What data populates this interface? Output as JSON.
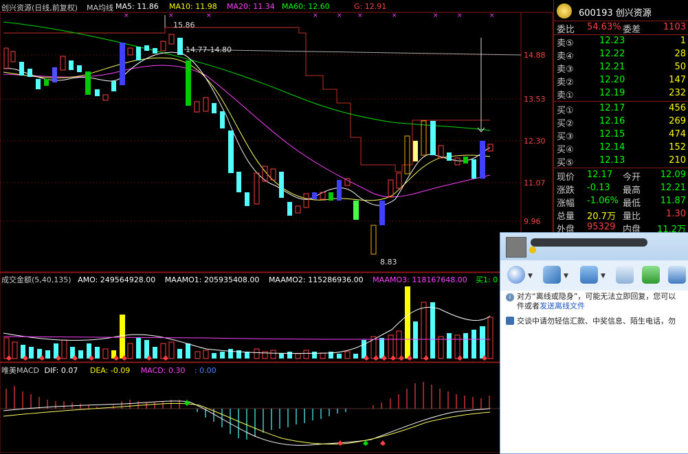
{
  "header": {
    "stock_name": "创兴资源(日线,前复权)",
    "ma_title": "MA均线",
    "ma5": "MA5: 11.86",
    "ma10": "MA10: 11.98",
    "ma20": "MA20: 11.34",
    "ma60": "MA60: 12.60",
    "g": "G: 12.91"
  },
  "price_labels": [
    "14.88",
    "13.53",
    "12.30",
    "11.07",
    "9.96"
  ],
  "annotations": {
    "high": "15.86",
    "range": "14.77-14.80",
    "low": "8.83"
  },
  "amount_header": {
    "title": "成交金额(5,40,135)",
    "amo": "AMO: 249564928.00",
    "maamo1": "MAAMO1: 205935408.00",
    "maamo2": "MAAMO2: 115286936.00",
    "maamo3": "MAAMO3: 118167648.00",
    "buy": "买1: 0"
  },
  "macd_header": {
    "title": "唯美MACD",
    "dif": "DIF: 0.07",
    "dea": "DEA: -0.09",
    "macd": "MACD: 0.30",
    "extra": ": 0.00"
  },
  "quote_panel": {
    "code": "600193 创兴资源",
    "webi_label": "委比",
    "webi_value": "54.63%",
    "weicha_label": "委差",
    "weicha_value": "1103",
    "sell": [
      {
        "label": "卖⑤",
        "price": "12.23",
        "vol": "1"
      },
      {
        "label": "卖④",
        "price": "12.22",
        "vol": "28"
      },
      {
        "label": "卖③",
        "price": "12.21",
        "vol": "50"
      },
      {
        "label": "卖②",
        "price": "12.20",
        "vol": "147"
      },
      {
        "label": "卖①",
        "price": "12.19",
        "vol": "232"
      }
    ],
    "buy": [
      {
        "label": "买①",
        "price": "12.17",
        "vol": "456"
      },
      {
        "label": "买②",
        "price": "12.16",
        "vol": "269"
      },
      {
        "label": "买③",
        "price": "12.15",
        "vol": "474"
      },
      {
        "label": "买④",
        "price": "12.14",
        "vol": "152"
      },
      {
        "label": "买⑤",
        "price": "12.13",
        "vol": "210"
      }
    ],
    "stats": [
      {
        "l1": "现价",
        "v1": "12.17",
        "l2": "今开",
        "v2": "12.09"
      },
      {
        "l1": "涨跌",
        "v1": "-0.13",
        "l2": "最高",
        "v2": "12.21"
      },
      {
        "l1": "涨幅",
        "v1": "-1.06%",
        "l2": "最低",
        "v2": "11.87"
      },
      {
        "l1": "总量",
        "v1": "20.7万",
        "l2": "量比",
        "v2": "1.30"
      },
      {
        "l1": "外盘",
        "v1": "95329",
        "l2": "内盘",
        "v2": "11.2万"
      }
    ]
  },
  "qq_window": {
    "msg1": "对方“离线或隐身”，可能无法立即回复，您可以",
    "msg1b": "件或者",
    "msg1_link": "发送离线文件",
    "msg2": "交谈中请勿轻信汇款、中奖信息、陌生电话，勿"
  },
  "colors": {
    "up": "#ff4040",
    "down": "#54ffff",
    "ma5": "#ffffff",
    "ma10": "#ffff00",
    "ma20": "#ff40ff",
    "ma60": "#00ff00",
    "grid": "#8b1a1a"
  }
}
